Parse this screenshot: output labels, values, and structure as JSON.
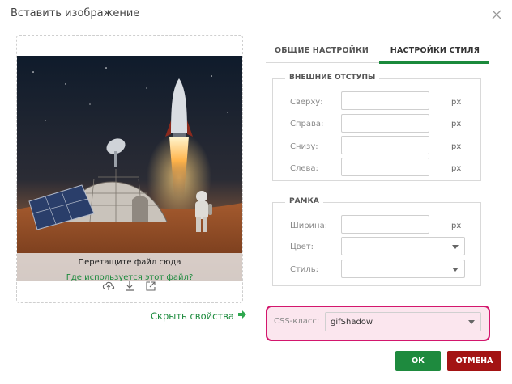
{
  "dialog": {
    "title": "Вставить изображение"
  },
  "image_panel": {
    "drop_text": "Перетащите файл сюда",
    "usage_link": "Где используется этот файл?",
    "hide_properties": "Скрыть свойства",
    "icons": [
      "upload-icon",
      "download-icon",
      "open-external-icon"
    ]
  },
  "tabs": [
    {
      "label": "ОБЩИЕ НАСТРОЙКИ",
      "active": false
    },
    {
      "label": "НАСТРОЙКИ СТИЛЯ",
      "active": true
    }
  ],
  "margins": {
    "legend": "ВНЕШНИЕ ОТСТУПЫ",
    "top": {
      "label": "Сверху:",
      "value": "",
      "unit": "px"
    },
    "right": {
      "label": "Справа:",
      "value": "",
      "unit": "px"
    },
    "bottom": {
      "label": "Снизу:",
      "value": "",
      "unit": "px"
    },
    "left": {
      "label": "Слева:",
      "value": "",
      "unit": "px"
    }
  },
  "border": {
    "legend": "РАМКА",
    "width": {
      "label": "Ширина:",
      "value": "",
      "unit": "px"
    },
    "color": {
      "label": "Цвет:",
      "value": ""
    },
    "style": {
      "label": "Стиль:",
      "value": ""
    }
  },
  "css_class": {
    "label": "CSS-класс:",
    "value": "gifShadow"
  },
  "buttons": {
    "ok": "ОК",
    "cancel": "ОТМЕНА"
  },
  "colors": {
    "accent": "#1b8a3c",
    "cancel": "#a31313",
    "highlight": "#d3166d"
  }
}
